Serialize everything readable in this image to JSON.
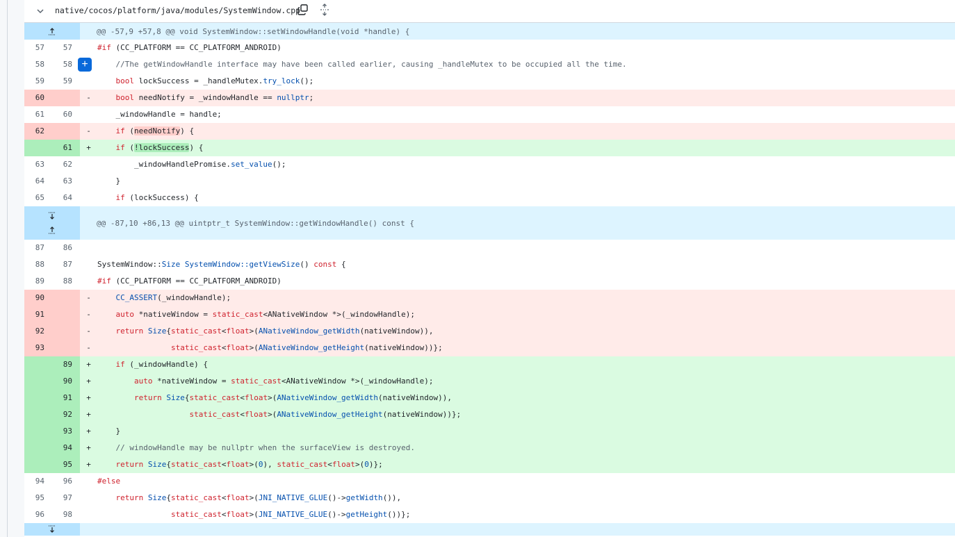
{
  "file": {
    "path": "native/cocos/platform/java/modules/SystemWindow.cpp"
  },
  "hunks": [
    {
      "header": "@@ -57,9 +57,8 @@ void SystemWindow::setWindowHandle(void *handle) {"
    },
    {
      "header": "@@ -87,10 +86,13 @@ uintptr_t SystemWindow::getWindowHandle() const {"
    }
  ],
  "colors": {
    "added_bg": "#dafbe1",
    "added_gutter": "#aceebb",
    "deleted_bg": "#ffebe9",
    "deleted_gutter": "#ffcecb",
    "hunk_bg": "#ddf4ff",
    "accent": "#0969da"
  }
}
